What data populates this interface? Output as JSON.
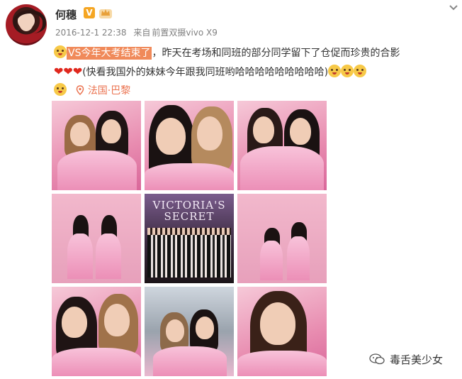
{
  "user": {
    "name": "何穗",
    "verified_badge": "V"
  },
  "meta": {
    "date": "2016-12-1 22:38",
    "source_prefix": "来自",
    "device": "前置双摄vivo X9"
  },
  "post": {
    "highlight": "VS今年大考结束了",
    "line1_rest": "，昨天在考场和同班的部分同学留下了仓促而珍贵的合影",
    "line2": "(快看我国外的妹妹今年跟我同班哟哈哈哈哈哈哈哈哈哈)",
    "location": "法国·巴黎"
  },
  "photo_text": {
    "brand_line1": "VICTORIA'S",
    "brand_line2": "SECRET"
  },
  "watermark": {
    "text": "毒舌美少女"
  },
  "colors": {
    "accent": "#eb7350",
    "highlight_bg": "#f08a5a",
    "verified": "#f5a623",
    "heart": "#e0281e"
  },
  "icons": [
    "avatar",
    "verified-icon",
    "crown-icon",
    "chevron-down-icon",
    "location-icon",
    "heart-icon",
    "emoji-icon",
    "wechat-icon"
  ]
}
